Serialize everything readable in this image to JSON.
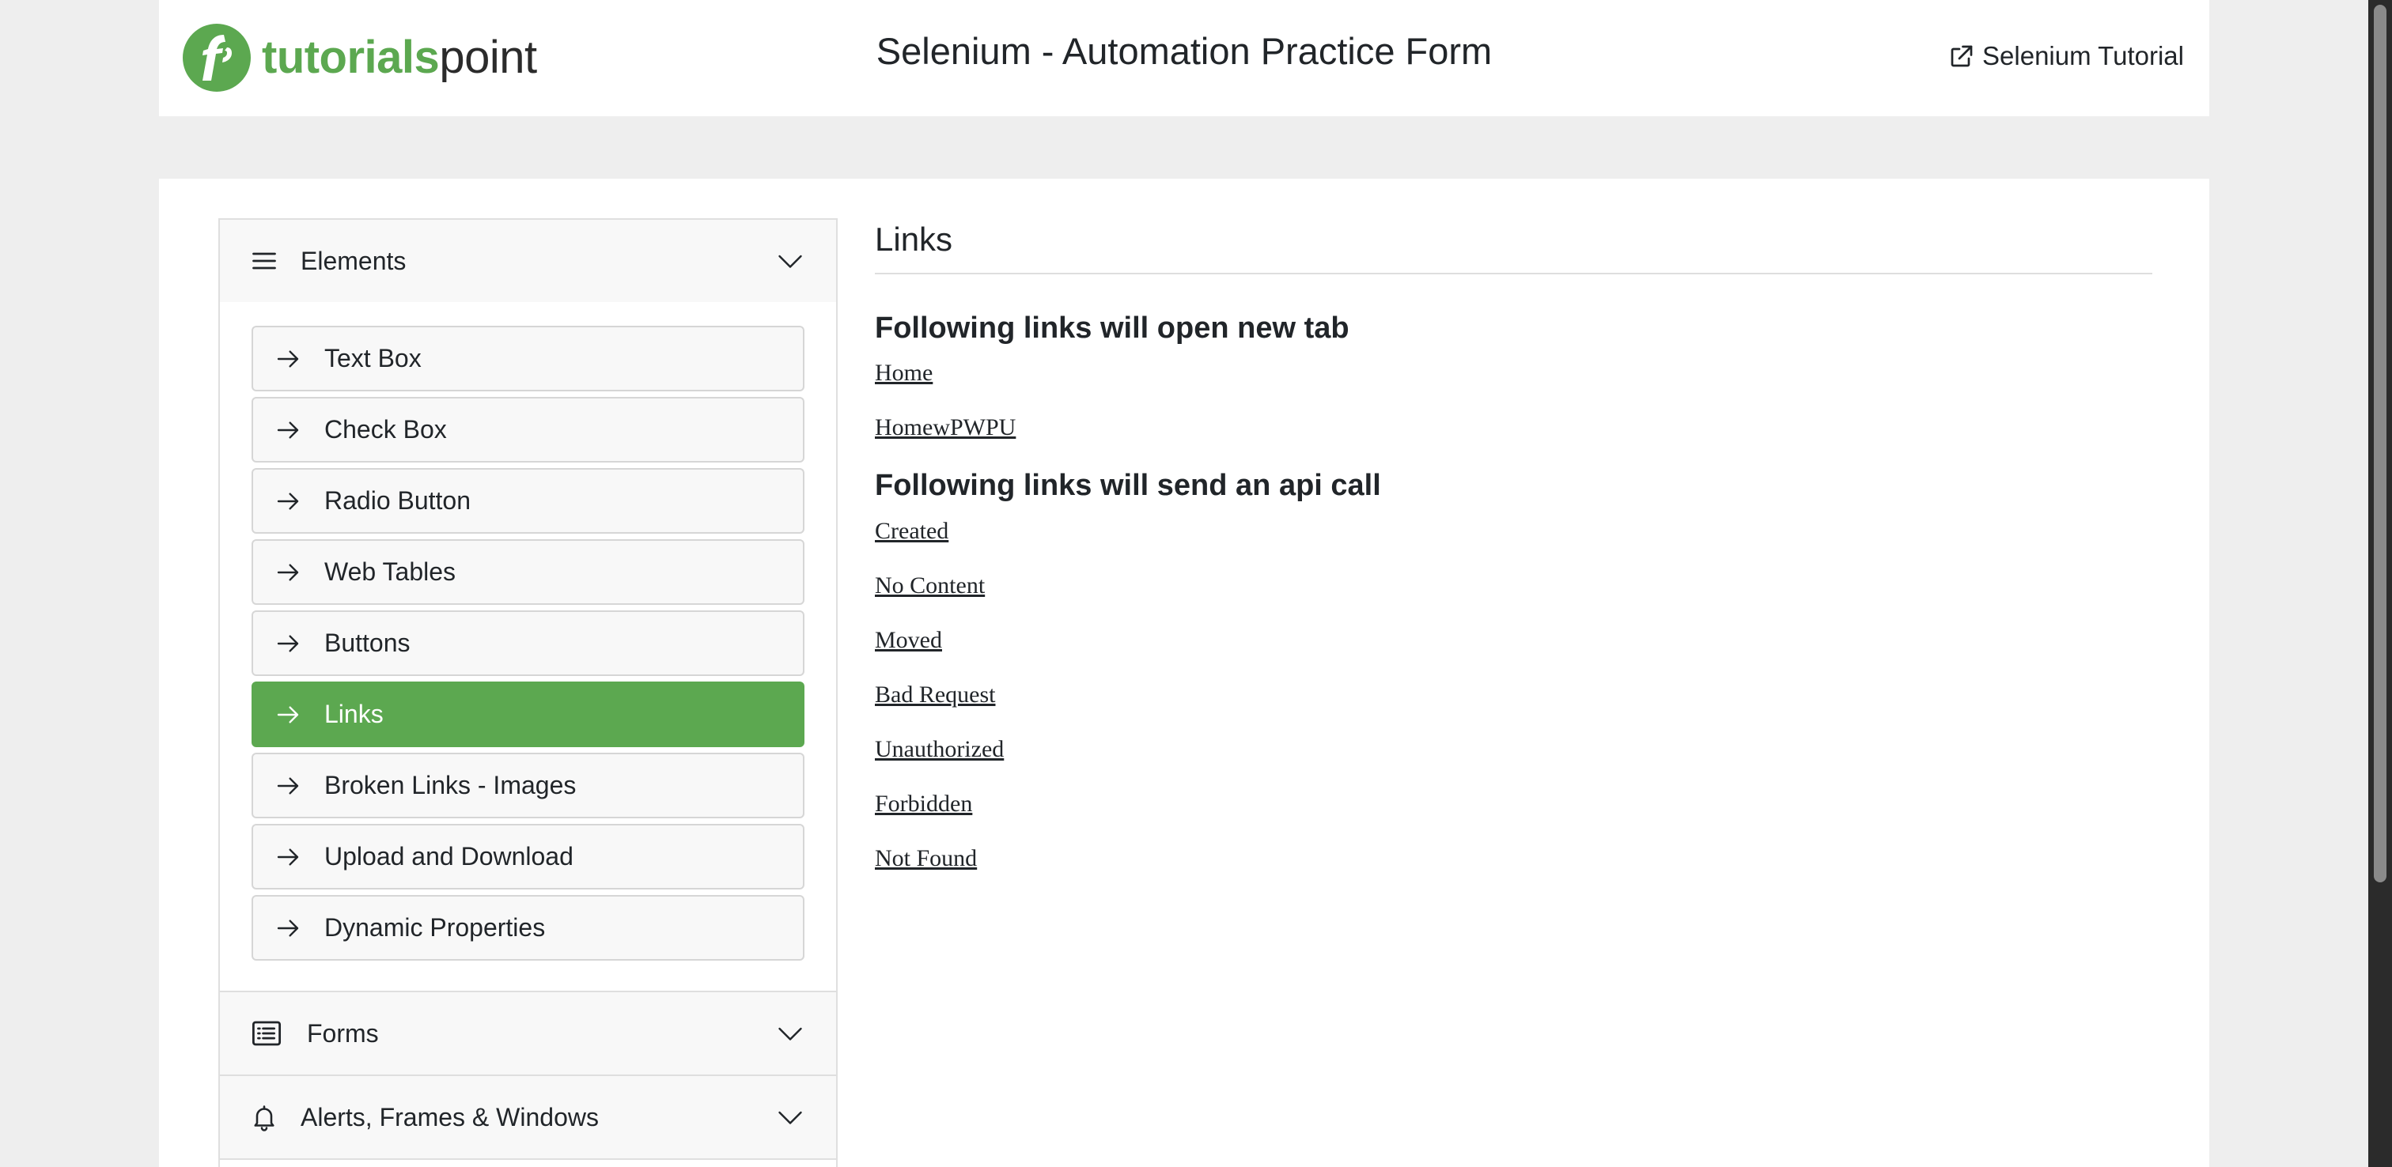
{
  "header": {
    "logo_part1": "tutorials",
    "logo_part2": "point",
    "title": "Selenium - Automation Practice Form",
    "tutorial_link": "Selenium Tutorial"
  },
  "sidebar": {
    "elements_section": {
      "label": "Elements",
      "items": [
        {
          "label": "Text Box",
          "active": false
        },
        {
          "label": "Check Box",
          "active": false
        },
        {
          "label": "Radio Button",
          "active": false
        },
        {
          "label": "Web Tables",
          "active": false
        },
        {
          "label": "Buttons",
          "active": false
        },
        {
          "label": "Links",
          "active": true
        },
        {
          "label": "Broken Links - Images",
          "active": false
        },
        {
          "label": "Upload and Download",
          "active": false
        },
        {
          "label": "Dynamic Properties",
          "active": false
        }
      ]
    },
    "forms_section": {
      "label": "Forms"
    },
    "alerts_section": {
      "label": "Alerts, Frames & Windows"
    }
  },
  "content": {
    "title": "Links",
    "new_tab_heading": "Following links will open new tab",
    "new_tab_links": [
      "Home",
      "HomewPWPU"
    ],
    "api_heading": "Following links will send an api call",
    "api_links": [
      "Created",
      "No Content",
      "Moved",
      "Bad Request",
      "Unauthorized",
      "Forbidden",
      "Not Found"
    ]
  },
  "colors": {
    "brand_green": "#5ca850",
    "page_background": "#eeeeee",
    "text": "#212529"
  },
  "icons": {
    "menu": "hamburger-icon",
    "arrow": "arrow-right-icon",
    "chevron": "chevron-down-icon",
    "forms": "list-icon",
    "alerts": "bell-icon",
    "external": "external-link-icon"
  }
}
